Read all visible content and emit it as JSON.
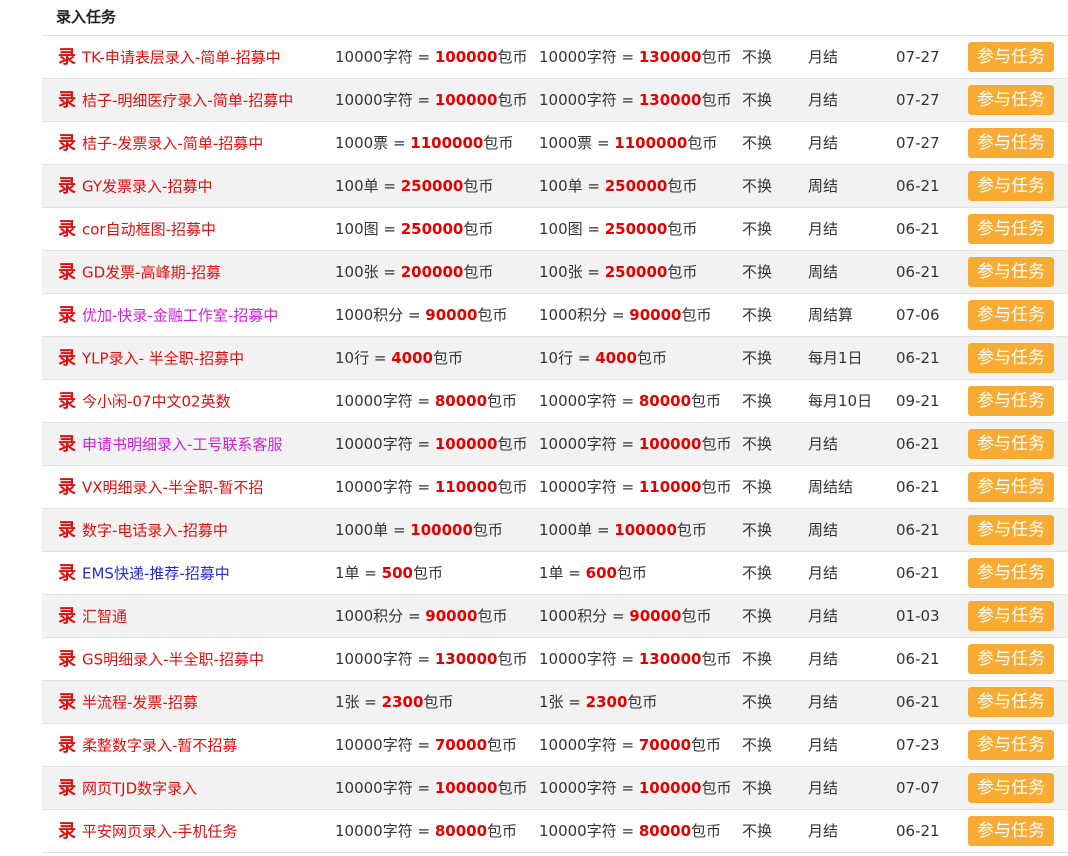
{
  "section": {
    "title": "录入任务"
  },
  "badge_char": "录",
  "join_label": "参与任务",
  "colors": {
    "name_red": "#e01010",
    "name_magenta": "#d020d8",
    "name_blue": "#2a2ad0",
    "amount_red": "#e60000",
    "button_orange": "#f7ab33"
  },
  "tasks": [
    {
      "name": "TK-申请表层录入-简单-招募中",
      "name_color": "#e01010",
      "price_unit": "10000字符 = ",
      "price_amount": "100000",
      "pay_unit": "10000字符 = ",
      "pay_amount": "130000",
      "currency": "包币",
      "swap": "不换",
      "settle": "月结",
      "date": "07-27"
    },
    {
      "name": "桔子-明细医疗录入-简单-招募中",
      "name_color": "#e01010",
      "price_unit": "10000字符 = ",
      "price_amount": "100000",
      "pay_unit": "10000字符 = ",
      "pay_amount": "130000",
      "currency": "包币",
      "swap": "不换",
      "settle": "月结",
      "date": "07-27"
    },
    {
      "name": "桔子-发票录入-简单-招募中",
      "name_color": "#e01010",
      "price_unit": "1000票 = ",
      "price_amount": "1100000",
      "pay_unit": "1000票 = ",
      "pay_amount": "1100000",
      "currency": "包币",
      "swap": "不换",
      "settle": "月结",
      "date": "07-27"
    },
    {
      "name": "GY发票录入-招募中",
      "name_color": "#e01010",
      "price_unit": "100单 = ",
      "price_amount": "250000",
      "pay_unit": "100单 = ",
      "pay_amount": "250000",
      "currency": "包币",
      "swap": "不换",
      "settle": "周结",
      "date": "06-21"
    },
    {
      "name": "cor自动框图-招募中",
      "name_color": "#e01010",
      "price_unit": "100图 = ",
      "price_amount": "250000",
      "pay_unit": "100图 = ",
      "pay_amount": "250000",
      "currency": "包币",
      "swap": "不换",
      "settle": "月结",
      "date": "06-21"
    },
    {
      "name": "GD发票-高峰期-招募",
      "name_color": "#e01010",
      "price_unit": "100张 = ",
      "price_amount": "200000",
      "pay_unit": "100张 = ",
      "pay_amount": "250000",
      "currency": "包币",
      "swap": "不换",
      "settle": "周结",
      "date": "06-21"
    },
    {
      "name": "优加-快录-金融工作室-招募中",
      "name_color": "#d020d8",
      "price_unit": "1000积分 = ",
      "price_amount": "90000",
      "pay_unit": "1000积分 = ",
      "pay_amount": "90000",
      "currency": "包币",
      "swap": "不换",
      "settle": "周结算",
      "date": "07-06"
    },
    {
      "name": "YLP录入- 半全职-招募中",
      "name_color": "#e01010",
      "price_unit": "10行 = ",
      "price_amount": "4000",
      "pay_unit": "10行 = ",
      "pay_amount": "4000",
      "currency": "包币",
      "swap": "不换",
      "settle": "每月1日",
      "date": "06-21"
    },
    {
      "name": "今小闲-07中文02英数",
      "name_color": "#e01010",
      "price_unit": "10000字符 = ",
      "price_amount": "80000",
      "pay_unit": "10000字符 = ",
      "pay_amount": "80000",
      "currency": "包币",
      "swap": "不换",
      "settle": "每月10日",
      "date": "09-21"
    },
    {
      "name": "申请书明细录入-工号联系客服",
      "name_color": "#d020d8",
      "price_unit": "10000字符 = ",
      "price_amount": "100000",
      "pay_unit": "10000字符 = ",
      "pay_amount": "100000",
      "currency": "包币",
      "swap": "不换",
      "settle": "月结",
      "date": "06-21"
    },
    {
      "name": "VX明细录入-半全职-暂不招",
      "name_color": "#e01010",
      "price_unit": "10000字符 = ",
      "price_amount": "110000",
      "pay_unit": "10000字符 = ",
      "pay_amount": "110000",
      "currency": "包币",
      "swap": "不换",
      "settle": "周结结",
      "date": "06-21"
    },
    {
      "name": "数字-电话录入-招募中",
      "name_color": "#e01010",
      "price_unit": "1000单 = ",
      "price_amount": "100000",
      "pay_unit": "1000单 = ",
      "pay_amount": "100000",
      "currency": "包币",
      "swap": "不换",
      "settle": "周结",
      "date": "06-21"
    },
    {
      "name": "EMS快递-推荐-招募中",
      "name_color": "#2a2ad0",
      "price_unit": "1单 = ",
      "price_amount": "500",
      "pay_unit": "1单 = ",
      "pay_amount": "600",
      "currency": "包币",
      "swap": "不换",
      "settle": "月结",
      "date": "06-21"
    },
    {
      "name": "汇智通",
      "name_color": "#e01010",
      "price_unit": "1000积分 = ",
      "price_amount": "90000",
      "pay_unit": "1000积分 = ",
      "pay_amount": "90000",
      "currency": "包币",
      "swap": "不换",
      "settle": "月结",
      "date": "01-03"
    },
    {
      "name": "GS明细录入-半全职-招募中",
      "name_color": "#e01010",
      "price_unit": "10000字符 = ",
      "price_amount": "130000",
      "pay_unit": "10000字符 = ",
      "pay_amount": "130000",
      "currency": "包币",
      "swap": "不换",
      "settle": "月结",
      "date": "06-21"
    },
    {
      "name": "半流程-发票-招募",
      "name_color": "#e01010",
      "price_unit": "1张 = ",
      "price_amount": "2300",
      "pay_unit": "1张 = ",
      "pay_amount": "2300",
      "currency": "包币",
      "swap": "不换",
      "settle": "月结",
      "date": "06-21"
    },
    {
      "name": "柔整数字录入-暂不招募",
      "name_color": "#e01010",
      "price_unit": "10000字符 = ",
      "price_amount": "70000",
      "pay_unit": "10000字符 = ",
      "pay_amount": "70000",
      "currency": "包币",
      "swap": "不换",
      "settle": "月结",
      "date": "07-23"
    },
    {
      "name": "网页TJD数字录入",
      "name_color": "#e01010",
      "price_unit": "10000字符 = ",
      "price_amount": "100000",
      "pay_unit": "10000字符 = ",
      "pay_amount": "100000",
      "currency": "包币",
      "swap": "不换",
      "settle": "月结",
      "date": "07-07"
    },
    {
      "name": "平安网页录入-手机任务",
      "name_color": "#e01010",
      "price_unit": "10000字符 = ",
      "price_amount": "80000",
      "pay_unit": "10000字符 = ",
      "pay_amount": "80000",
      "currency": "包币",
      "swap": "不换",
      "settle": "月结",
      "date": "06-21"
    }
  ]
}
